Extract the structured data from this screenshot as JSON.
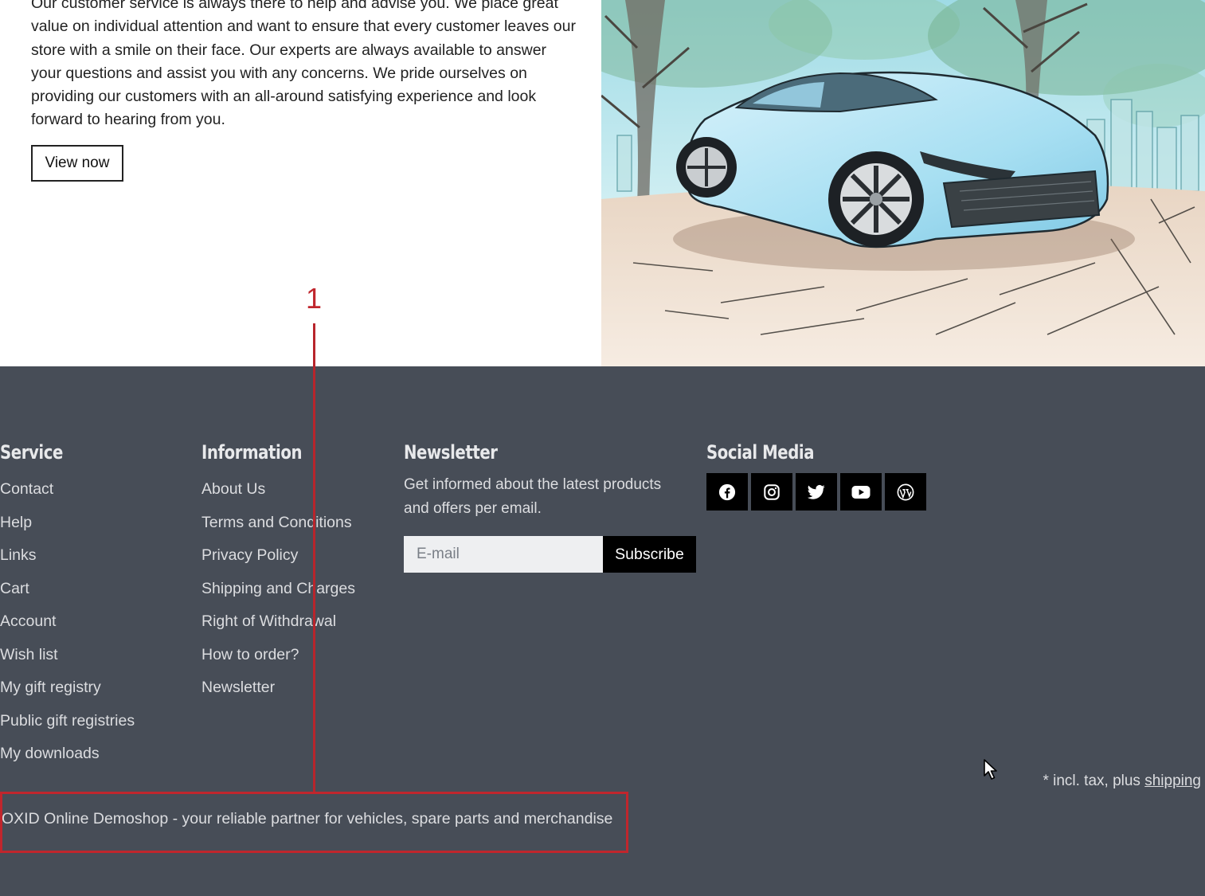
{
  "intro": {
    "text": "Our customer service is always there to help and advise you. We place great value on individual attention and want to ensure that every customer leaves our store with a smile on their face. Our experts are always available to answer your questions and assist you with any concerns. We pride ourselves on providing our customers with an all-around satisfying experience and look forward to hearing from you.",
    "button_label": "View now"
  },
  "footer": {
    "service": {
      "title": "Service",
      "links": [
        "Contact",
        "Help",
        "Links",
        "Cart",
        "Account",
        "Wish list",
        "My gift registry",
        "Public gift registries",
        "My downloads"
      ]
    },
    "information": {
      "title": "Information",
      "links": [
        "About Us",
        "Terms and Conditions",
        "Privacy Policy",
        "Shipping and Charges",
        "Right of Withdrawal",
        "How to order?",
        "Newsletter"
      ]
    },
    "newsletter": {
      "title": "Newsletter",
      "description": "Get informed about the latest products and offers per email.",
      "email_placeholder": "E-mail",
      "subscribe_label": "Subscribe"
    },
    "social": {
      "title": "Social Media",
      "icons": [
        "facebook-icon",
        "instagram-icon",
        "twitter-icon",
        "youtube-icon",
        "wordpress-icon"
      ]
    },
    "tax_note_prefix": "* incl. tax, plus ",
    "tax_note_link": "shipping",
    "tagline": "OXID Online Demoshop - your reliable partner for vehicles, spare parts and merchandise",
    "background_color": "#474d57"
  },
  "annotation": {
    "number": "1",
    "color": "#c0262d"
  }
}
